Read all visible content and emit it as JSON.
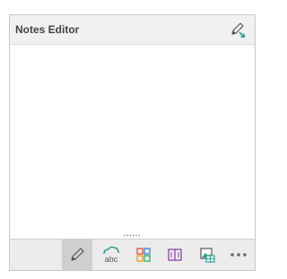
{
  "header": {
    "title": "Notes Editor",
    "action_icon": "pen-edit-icon"
  },
  "content": {
    "text": ""
  },
  "toolbar": {
    "active_tool": "pencil",
    "tools": [
      {
        "icon": "pencil-icon",
        "active": true
      },
      {
        "icon": "cloud-abc-icon",
        "active": false
      },
      {
        "icon": "color-grid-icon",
        "active": false
      },
      {
        "icon": "book-icon",
        "active": false
      },
      {
        "icon": "image-table-icon",
        "active": false
      },
      {
        "icon": "more-dots-icon",
        "active": false
      }
    ],
    "cloud_label": "abc"
  },
  "colors": {
    "header_bg": "#f1f1f1",
    "toolbar_bg": "#ececec",
    "active_tool_bg": "#cfcfcf",
    "accent_teal": "#2a9d8f",
    "icon_purple": "#8e44ad",
    "grid_red": "#e74c3c",
    "grid_blue": "#2e86de",
    "grid_green": "#27ae60",
    "grid_orange": "#f39c12"
  }
}
